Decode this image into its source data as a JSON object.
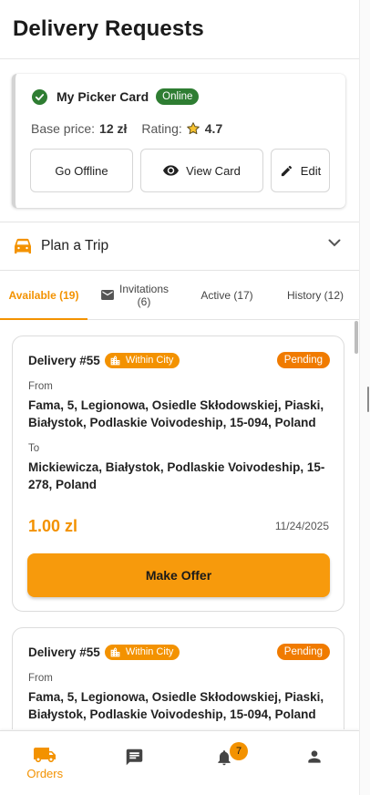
{
  "header": {
    "title": "Delivery Requests"
  },
  "picker_card": {
    "title": "My Picker Card",
    "status": "Online",
    "base_price_label": "Base price:",
    "base_price_value": "12 zł",
    "rating_label": "Rating:",
    "rating_value": "4.7",
    "buttons": {
      "offline": "Go Offline",
      "view": "View Card",
      "edit": "Edit"
    }
  },
  "plan_trip": {
    "label": "Plan a Trip"
  },
  "tabs": [
    {
      "label": "Available (19)",
      "active": true
    },
    {
      "label_line1": "Invitations",
      "label_line2": "(6)"
    },
    {
      "label": "Active (17)"
    },
    {
      "label": "History (12)"
    }
  ],
  "deliveries": [
    {
      "id": "Delivery #55",
      "scope": "Within City",
      "status": "Pending",
      "from_label": "From",
      "from": "Fama, 5, Legionowa, Osiedle Skłodowskiej, Piaski, Białystok, Podlaskie Voivodeship, 15-094, Poland",
      "to_label": "To",
      "to": "Mickiewicza, Białystok, Podlaskie Voivodeship, 15-278, Poland",
      "price": "1.00 zl",
      "date": "11/24/2025",
      "action": "Make Offer"
    },
    {
      "id": "Delivery #55",
      "scope": "Within City",
      "status": "Pending",
      "from_label": "From",
      "from": "Fama, 5, Legionowa, Osiedle Skłodowskiej, Piaski, Białystok, Podlaskie Voivodeship, 15-094, Poland"
    }
  ],
  "bottom_nav": {
    "orders_label": "Orders",
    "notifications_count": "7"
  },
  "colors": {
    "accent": "#f39200",
    "online": "#2e7d32",
    "pending": "#f07b00"
  }
}
